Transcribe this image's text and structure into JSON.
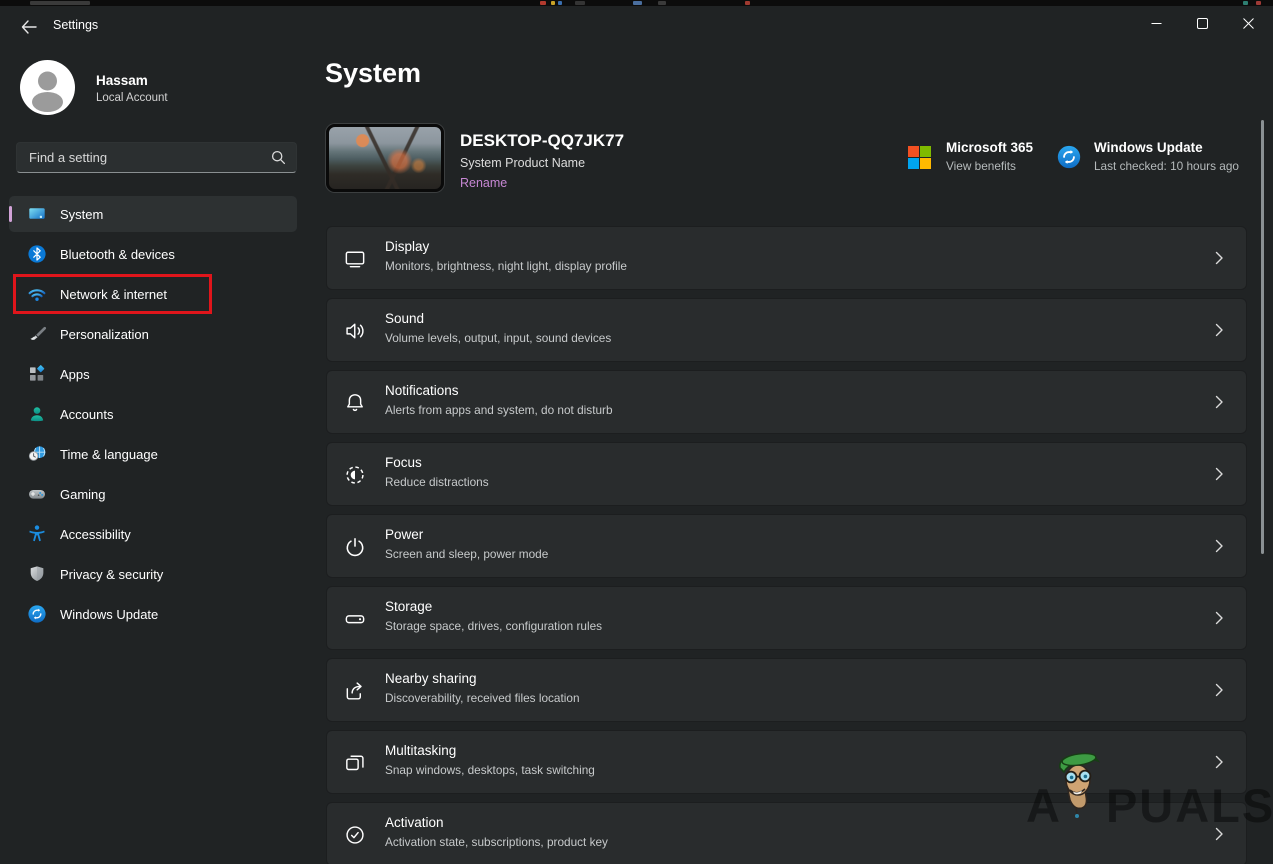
{
  "titlebar": {
    "title": "Settings",
    "controls": [
      "minimize",
      "maximize",
      "close"
    ]
  },
  "user": {
    "name": "Hassam",
    "account_type": "Local Account"
  },
  "search": {
    "placeholder": "Find a setting"
  },
  "sidebar": {
    "selected": "System",
    "highlighted": "Network & internet",
    "items": [
      {
        "label": "System",
        "icon": "display-icon"
      },
      {
        "label": "Bluetooth & devices",
        "icon": "bluetooth-icon"
      },
      {
        "label": "Network & internet",
        "icon": "wifi-icon"
      },
      {
        "label": "Personalization",
        "icon": "paintbrush-icon"
      },
      {
        "label": "Apps",
        "icon": "apps-icon"
      },
      {
        "label": "Accounts",
        "icon": "person-icon"
      },
      {
        "label": "Time & language",
        "icon": "clock-globe-icon"
      },
      {
        "label": "Gaming",
        "icon": "gamepad-icon"
      },
      {
        "label": "Accessibility",
        "icon": "accessibility-icon"
      },
      {
        "label": "Privacy & security",
        "icon": "shield-icon"
      },
      {
        "label": "Windows Update",
        "icon": "update-icon"
      }
    ]
  },
  "main": {
    "page_title": "System"
  },
  "device": {
    "name": "DESKTOP-QQ7JK77",
    "subtitle": "System Product Name",
    "rename_label": "Rename"
  },
  "promos": {
    "microsoft365": {
      "title": "Microsoft 365",
      "subtitle": "View benefits"
    },
    "windows_update": {
      "title": "Windows Update",
      "subtitle": "Last checked: 10 hours ago"
    }
  },
  "rows": [
    {
      "title": "Display",
      "subtitle": "Monitors, brightness, night light, display profile",
      "icon": "display-icon"
    },
    {
      "title": "Sound",
      "subtitle": "Volume levels, output, input, sound devices",
      "icon": "speaker-icon"
    },
    {
      "title": "Notifications",
      "subtitle": "Alerts from apps and system, do not disturb",
      "icon": "bell-icon"
    },
    {
      "title": "Focus",
      "subtitle": "Reduce distractions",
      "icon": "focus-icon"
    },
    {
      "title": "Power",
      "subtitle": "Screen and sleep, power mode",
      "icon": "power-icon"
    },
    {
      "title": "Storage",
      "subtitle": "Storage space, drives, configuration rules",
      "icon": "storage-icon"
    },
    {
      "title": "Nearby sharing",
      "subtitle": "Discoverability, received files location",
      "icon": "share-icon"
    },
    {
      "title": "Multitasking",
      "subtitle": "Snap windows, desktops, task switching",
      "icon": "multitask-icon"
    },
    {
      "title": "Activation",
      "subtitle": "Activation state, subscriptions, product key",
      "icon": "check-circle-icon"
    }
  ],
  "watermark": {
    "prefix": "A",
    "suffix": "PUALS"
  },
  "colors": {
    "accent_purple": "#c687d3",
    "selected_pill": "#d2a3d8",
    "highlight_red": "#e0151b",
    "page_bg": "#202324",
    "card_bg": "#292c2d",
    "selected_item_bg": "#2d3132",
    "ms_logo": [
      "#f25022",
      "#7fba00",
      "#00a4ef",
      "#ffb900"
    ],
    "update_blue": "#1781d7"
  }
}
